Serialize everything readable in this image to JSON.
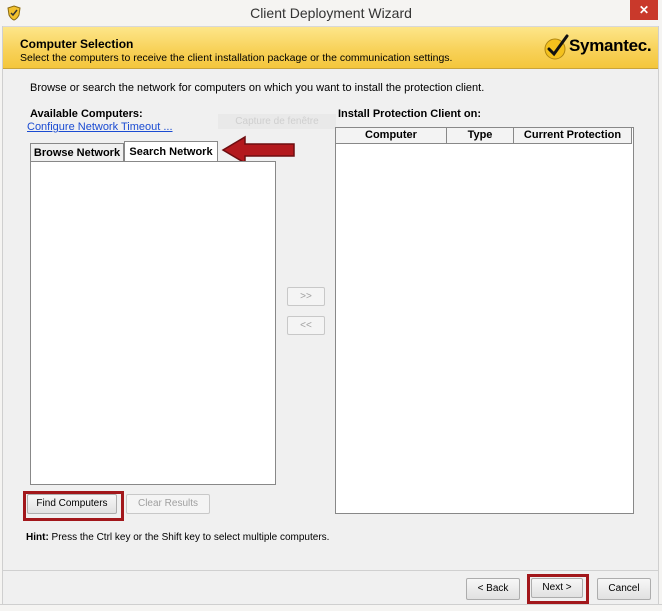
{
  "window": {
    "title": "Client Deployment Wizard",
    "close_glyph": "✕"
  },
  "header": {
    "title": "Computer Selection",
    "subtitle": "Select the computers to receive the client installation package or the communication settings.",
    "logo_text": "Symantec.",
    "logo_mark": "✓"
  },
  "instruction": "Browse or search the network for computers on which you want to install the protection client.",
  "available": {
    "label": "Available Computers:",
    "timeout_link": "Configure Network Timeout ...",
    "tabs": [
      {
        "label": "Browse Network"
      },
      {
        "label": "Search Network"
      }
    ],
    "active_tab": 1
  },
  "ghost_overlay": "Capture de fenêtre",
  "transfer": {
    "add": ">>",
    "remove": "<<"
  },
  "actions": {
    "find": "Find Computers",
    "clear": "Clear Results"
  },
  "install": {
    "label": "Install Protection Client on:",
    "columns": [
      "Computer",
      "Type",
      "Current Protection"
    ]
  },
  "hint": {
    "prefix": "Hint:",
    "text": " Press the Ctrl key or the Shift key to select multiple computers."
  },
  "footer": {
    "back": "< Back",
    "next": "Next >",
    "cancel": "Cancel"
  },
  "colors": {
    "header_gold": "#f8d25a",
    "highlight_red": "#a2171b",
    "link_blue": "#1a4bd2",
    "close_red": "#c9392b"
  }
}
